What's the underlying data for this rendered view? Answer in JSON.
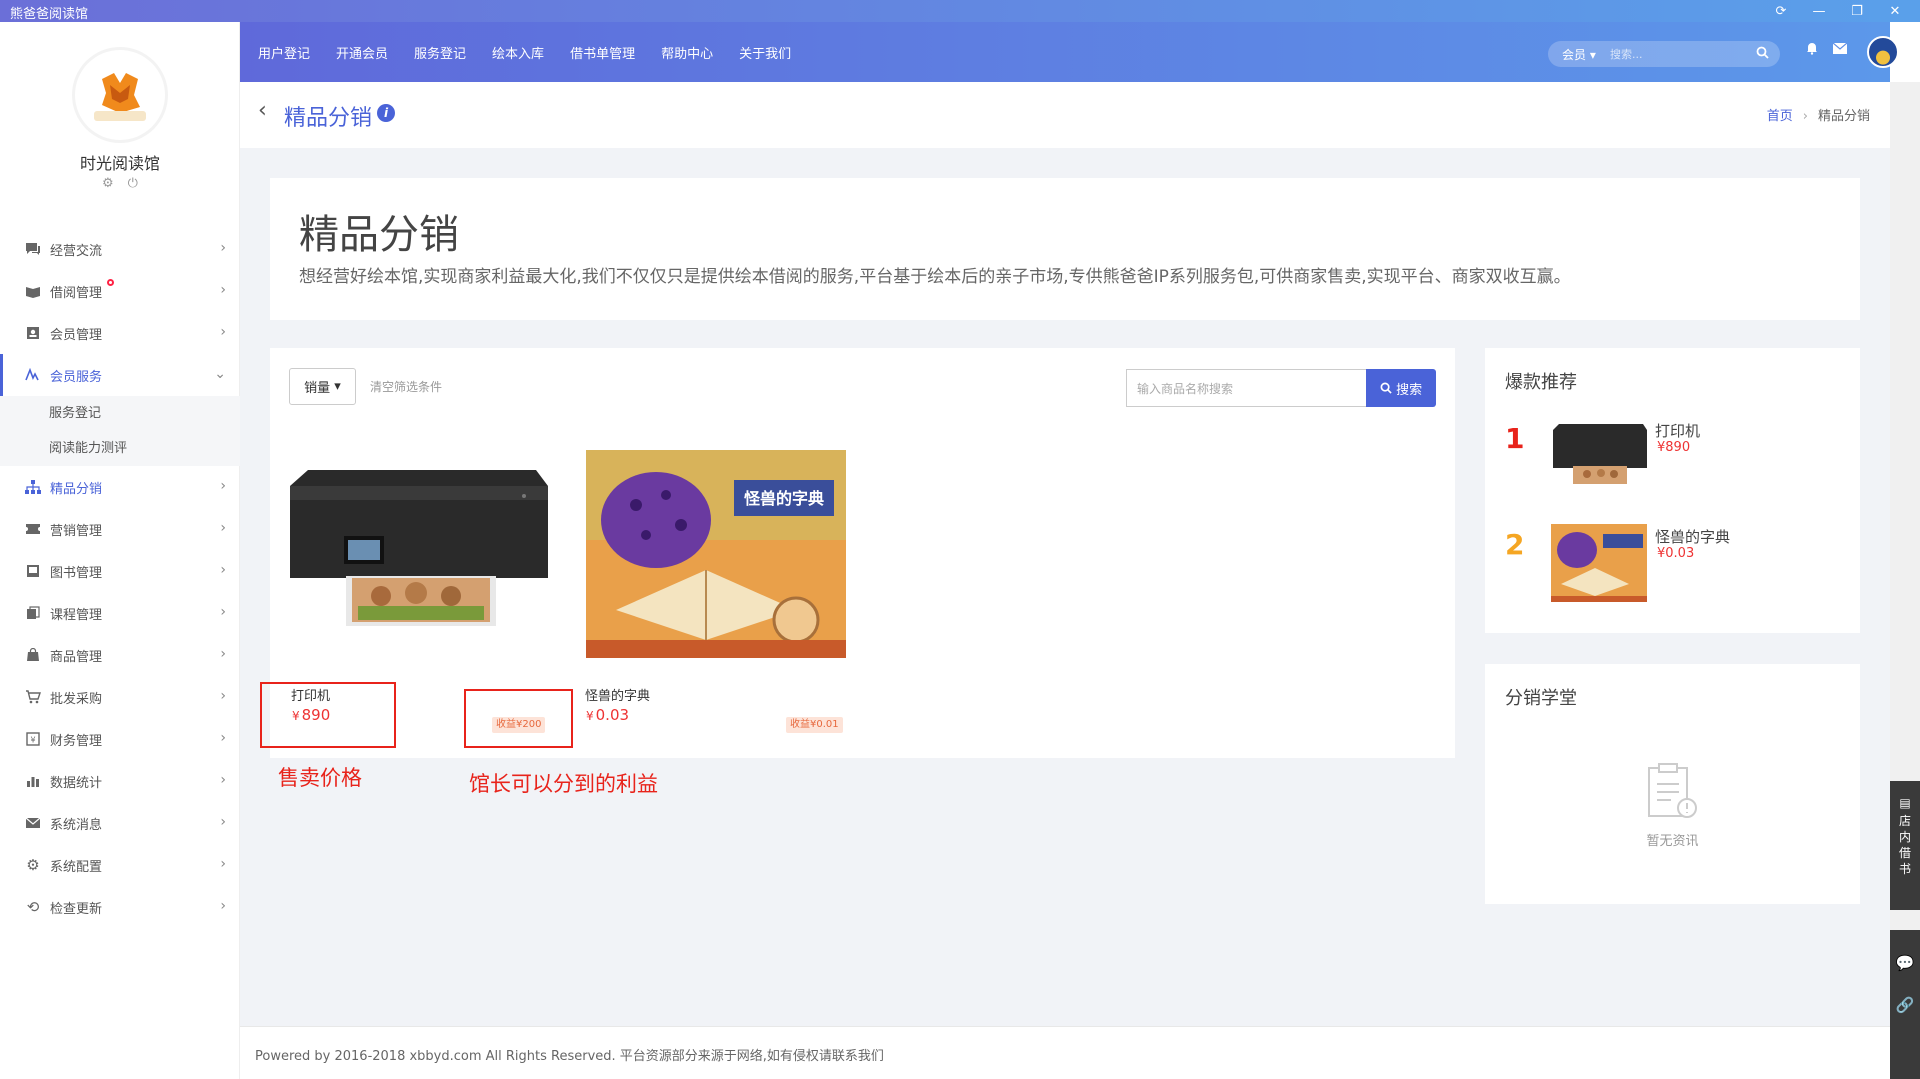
{
  "app": {
    "title": "熊爸爸阅读馆"
  },
  "window_controls": [
    "refresh-icon",
    "minimize-icon",
    "restore-icon",
    "close-icon"
  ],
  "sidebar": {
    "logo_text": "熊爸爸阅读馆",
    "store_name": "时光阅读馆",
    "store_icons": [
      "gear-icon",
      "power-icon"
    ],
    "items": [
      {
        "label": "经营交流",
        "icon": "chat-icon"
      },
      {
        "label": "借阅管理",
        "icon": "book-open-icon"
      },
      {
        "label": "会员管理",
        "icon": "member-card-icon"
      },
      {
        "label": "会员服务",
        "icon": "service-icon"
      },
      {
        "label": "精品分销",
        "icon": "sitemap-icon"
      },
      {
        "label": "营销管理",
        "icon": "ticket-icon"
      },
      {
        "label": "图书管理",
        "icon": "book-icon"
      },
      {
        "label": "课程管理",
        "icon": "course-icon"
      },
      {
        "label": "商品管理",
        "icon": "bag-icon"
      },
      {
        "label": "批发采购",
        "icon": "cart-icon"
      },
      {
        "label": "财务管理",
        "icon": "finance-icon"
      },
      {
        "label": "数据统计",
        "icon": "bar-chart-icon"
      },
      {
        "label": "系统消息",
        "icon": "mail-icon"
      },
      {
        "label": "系统配置",
        "icon": "settings-icon"
      },
      {
        "label": "检查更新",
        "icon": "sync-icon"
      }
    ],
    "submenu": [
      "服务登记",
      "阅读能力测评"
    ]
  },
  "topnav": {
    "links": [
      "用户登记",
      "开通会员",
      "服务登记",
      "绘本入库",
      "借书单管理",
      "帮助中心",
      "关于我们"
    ],
    "search_select": "会员",
    "search_placeholder": "搜索..."
  },
  "page": {
    "title": "精品分销",
    "breadcrumb_home": "首页",
    "breadcrumb_current": "精品分销"
  },
  "hero": {
    "title": "精品分销",
    "description": "想经营好绘本馆,实现商家利益最大化,我们不仅仅只是提供绘本借阅的服务,平台基于绘本后的亲子市场,专供熊爸爸IP系列服务包,可供商家售卖,实现平台、商家双收互赢。"
  },
  "filters": {
    "sort_label": "销量",
    "clear_label": "清空筛选条件",
    "search_placeholder": "输入商品名称搜索",
    "search_button": "搜索"
  },
  "products": [
    {
      "name": "打印机",
      "price": "890",
      "currency": "¥",
      "commission": "收益¥200"
    },
    {
      "name": "怪兽的字典",
      "price": "0.03",
      "currency": "¥",
      "commission": "收益¥0.01"
    }
  ],
  "annotations": {
    "price_note": "售卖价格",
    "profit_note": "馆长可以分到的利益"
  },
  "hot": {
    "title": "爆款推荐",
    "items": [
      {
        "rank": "1",
        "name": "打印机",
        "price": "¥890"
      },
      {
        "rank": "2",
        "name": "怪兽的字典",
        "price": "¥0.03"
      }
    ]
  },
  "school": {
    "title": "分销学堂",
    "empty": "暂无资讯"
  },
  "rail": {
    "borrow_label": "店内借书"
  },
  "footer": {
    "text": "Powered by 2016-2018 xbbyd.com All Rights Reserved. 平台资源部分来源于网络,如有侵权请联系我们"
  },
  "colors": {
    "accent": "#4a63d8",
    "price": "#e33333",
    "annotation": "#e8231b",
    "rank1": "#e8231b",
    "rank2": "#f5a623"
  }
}
